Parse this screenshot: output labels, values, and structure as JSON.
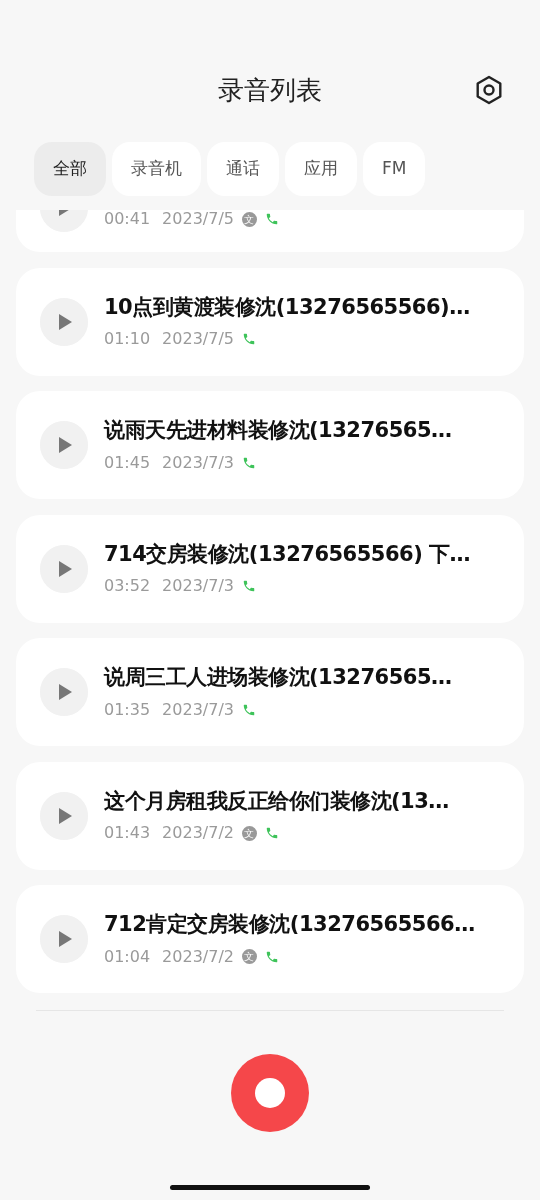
{
  "title": "录音列表",
  "tabs": [
    {
      "label": "全部",
      "selected": true
    },
    {
      "label": "录音机",
      "selected": false
    },
    {
      "label": "通话",
      "selected": false
    },
    {
      "label": "应用",
      "selected": false
    },
    {
      "label": "FM",
      "selected": false
    }
  ],
  "recordings": [
    {
      "duration": "00:41",
      "date": "2023/7/5",
      "badge": "文",
      "call": true
    },
    {
      "title": "10点到黄渡装修沈(13276565566)…",
      "duration": "01:10",
      "date": "2023/7/5",
      "call": true
    },
    {
      "title": "说雨天先进材料装修沈(13276565…",
      "duration": "01:45",
      "date": "2023/7/3",
      "call": true
    },
    {
      "title": "714交房装修沈(13276565566) 下…",
      "duration": "03:52",
      "date": "2023/7/3",
      "call": true
    },
    {
      "title": "说周三工人进场装修沈(13276565…",
      "duration": "01:35",
      "date": "2023/7/3",
      "call": true
    },
    {
      "title": "这个月房租我反正给你们装修沈(13…",
      "duration": "01:43",
      "date": "2023/7/2",
      "badge": "文",
      "call": true
    },
    {
      "title": "712肯定交房装修沈(13276565566…",
      "duration": "01:04",
      "date": "2023/7/2",
      "badge": "文",
      "call": true
    }
  ]
}
